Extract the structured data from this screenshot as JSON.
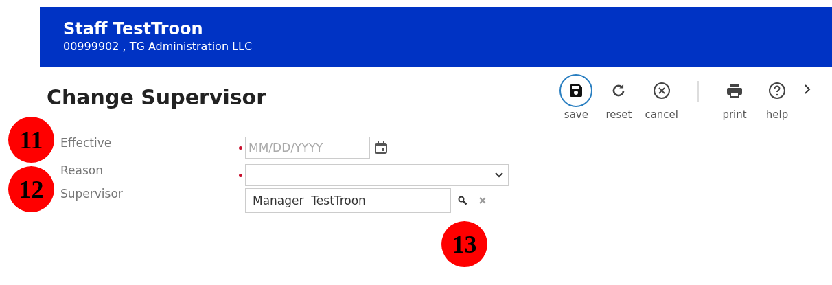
{
  "header": {
    "name": "Staff TestTroon",
    "subtitle": "00999902 , TG Administration LLC"
  },
  "page_title": "Change Supervisor",
  "toolbar": [
    {
      "kind": "save",
      "label": "save",
      "focused": true
    },
    {
      "kind": "reset",
      "label": "reset",
      "focused": false
    },
    {
      "kind": "cancel",
      "label": "cancel",
      "focused": false
    },
    {
      "kind": "divider"
    },
    {
      "kind": "print",
      "label": "print",
      "focused": false
    },
    {
      "kind": "help",
      "label": "help",
      "focused": false
    },
    {
      "kind": "more"
    }
  ],
  "fields": [
    {
      "kind": "date",
      "label": "Effective",
      "required": true,
      "placeholder": "MM/DD/YYYY"
    },
    {
      "kind": "select",
      "label": "Reason",
      "required": true
    },
    {
      "kind": "lookup",
      "label": "Supervisor",
      "required": false,
      "value": "Manager  TestTroon"
    }
  ],
  "callouts": [
    {
      "number": "11"
    },
    {
      "number": "12"
    },
    {
      "number": "13"
    }
  ]
}
